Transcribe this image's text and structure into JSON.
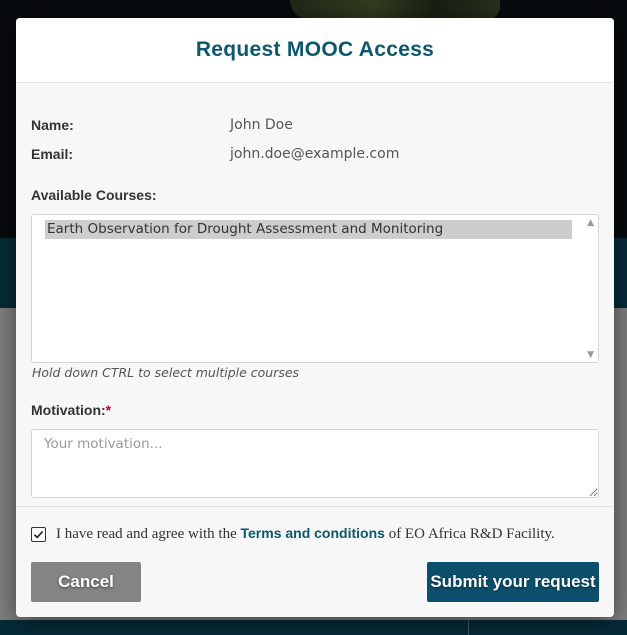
{
  "modal": {
    "title": "Request MOOC Access"
  },
  "user": {
    "name_label": "Name:",
    "name_value": "John Doe",
    "email_label": "Email:",
    "email_value": "john.doe@example.com"
  },
  "courses": {
    "label": "Available Courses:",
    "options": [
      "Earth Observation for Drought Assessment and Monitoring"
    ],
    "hint": "Hold down CTRL to select multiple courses"
  },
  "motivation": {
    "label": "Motivation:",
    "required_marker": "*",
    "placeholder": "Your motivation...",
    "value": ""
  },
  "agreement": {
    "checked": true,
    "text_before": "I have read and agree with the",
    "link_text": "Terms and conditions",
    "text_after": "of EO Africa R&D Facility."
  },
  "buttons": {
    "cancel_label": "Cancel",
    "submit_label": "Submit your request"
  },
  "icons": {
    "checkbox": "check-icon",
    "scroll_up": "chevron-up-icon",
    "scroll_down": "chevron-down-icon"
  },
  "colors": {
    "brand": "#0b5770",
    "submit_bg": "#0b4f6c",
    "cancel_bg": "#848484",
    "required": "#d0021b"
  }
}
